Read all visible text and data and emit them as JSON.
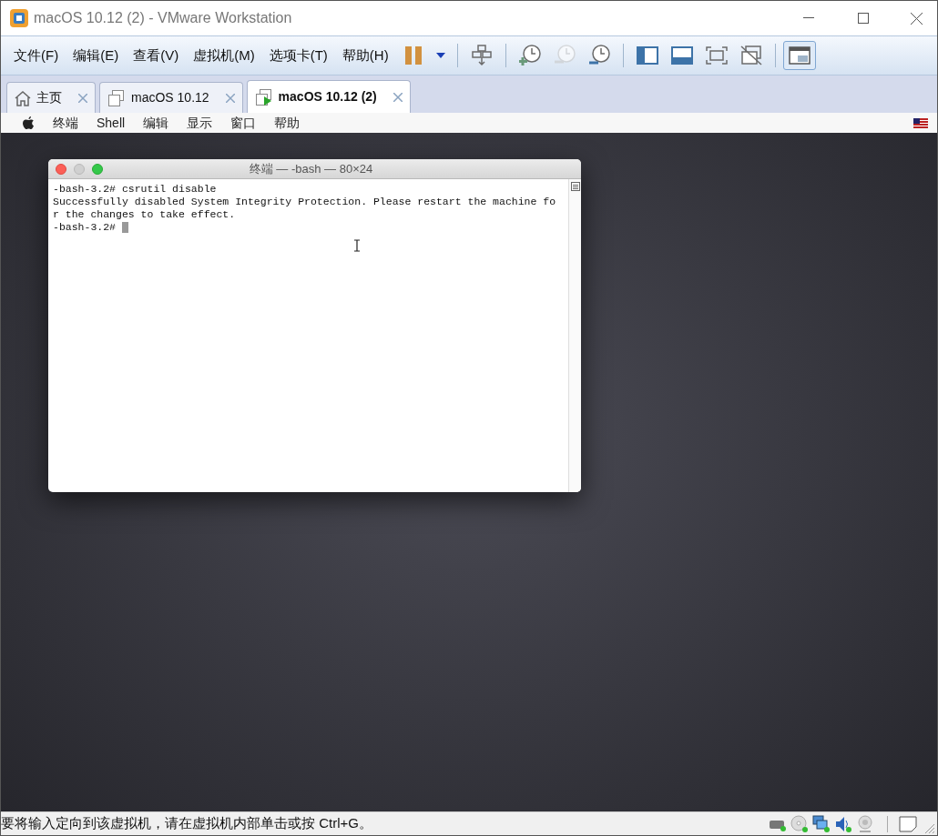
{
  "window": {
    "title": "macOS 10.12 (2) - VMware Workstation"
  },
  "menu": [
    "文件(F)",
    "编辑(E)",
    "查看(V)",
    "虚拟机(M)",
    "选项卡(T)",
    "帮助(H)"
  ],
  "toolbar": [
    {
      "kind": "pause",
      "disabled": false,
      "selected": false
    },
    {
      "kind": "dropdown",
      "disabled": false,
      "selected": false
    },
    {
      "kind": "sep"
    },
    {
      "kind": "send-keys",
      "disabled": false,
      "selected": false
    },
    {
      "kind": "sep"
    },
    {
      "kind": "snapshot",
      "disabled": false,
      "selected": false
    },
    {
      "kind": "revert",
      "disabled": true,
      "selected": false
    },
    {
      "kind": "manage",
      "disabled": false,
      "selected": false
    },
    {
      "kind": "sep"
    },
    {
      "kind": "sidebar",
      "disabled": false,
      "selected": false
    },
    {
      "kind": "thumbs",
      "disabled": false,
      "selected": false
    },
    {
      "kind": "fullscreen",
      "disabled": false,
      "selected": false
    },
    {
      "kind": "unity",
      "disabled": false,
      "selected": false
    },
    {
      "kind": "sep"
    },
    {
      "kind": "console",
      "disabled": false,
      "selected": true
    }
  ],
  "tabs": [
    {
      "kind": "home",
      "label": "主页",
      "selected": false
    },
    {
      "kind": "vm",
      "label": "macOS 10.12",
      "selected": false
    },
    {
      "kind": "vm-running",
      "label": "macOS 10.12 (2)",
      "selected": true
    }
  ],
  "mac_menu": [
    "终端",
    "Shell",
    "编辑",
    "显示",
    "窗口",
    "帮助"
  ],
  "terminal": {
    "title": "终端 — -bash — 80×24",
    "lines": [
      "-bash-3.2# csrutil disable",
      "Successfully disabled System Integrity Protection. Please restart the machine fo",
      "r the changes to take effect."
    ],
    "prompt": "-bash-3.2#"
  },
  "status_bar": {
    "text": "要将输入定向到该虚拟机，请在虚拟机内部单击或按 Ctrl+G。"
  }
}
